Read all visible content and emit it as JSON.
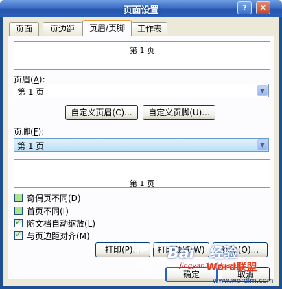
{
  "window": {
    "title": "页面设置"
  },
  "tabs": [
    {
      "label": "页面",
      "selected": false
    },
    {
      "label": "页边距",
      "selected": false
    },
    {
      "label": "页眉/页脚",
      "selected": true
    },
    {
      "label": "工作表",
      "selected": false
    }
  ],
  "header_preview": {
    "text": "第 1 页"
  },
  "header": {
    "label_prefix": "页眉(",
    "label_key": "A",
    "label_suffix": "):",
    "value": "第 1 页"
  },
  "custom_header_button": "自定义页眉(C)...",
  "custom_footer_button": "自定义页脚(U)...",
  "footer": {
    "label_prefix": "页脚(",
    "label_key": "F",
    "label_suffix": "):",
    "value": "第 1 页"
  },
  "footer_preview": {
    "text": "第 1 页"
  },
  "options": [
    {
      "label": "奇偶页不同(D)",
      "checked": false
    },
    {
      "label": "首页不同(I)",
      "checked": false
    },
    {
      "label": "随文档自动缩放(L)",
      "checked": true
    },
    {
      "label": "与页边距对齐(M)",
      "checked": true
    }
  ],
  "buttons": {
    "print": "打印(P)...",
    "print_preview": "打印预览(W)",
    "options": "选项(O)...",
    "ok": "确定",
    "cancel": "取消"
  },
  "watermark": {
    "text1": "Word联盟",
    "text2": "www.wordlm.com",
    "text3": "Bai",
    "text4": "经验",
    "text5": "jingyan.baidu.com"
  },
  "colors": {
    "titlebar": "#2b5fbd",
    "client": "#ece9d8",
    "active_tab_accent": "#e8a13e"
  }
}
